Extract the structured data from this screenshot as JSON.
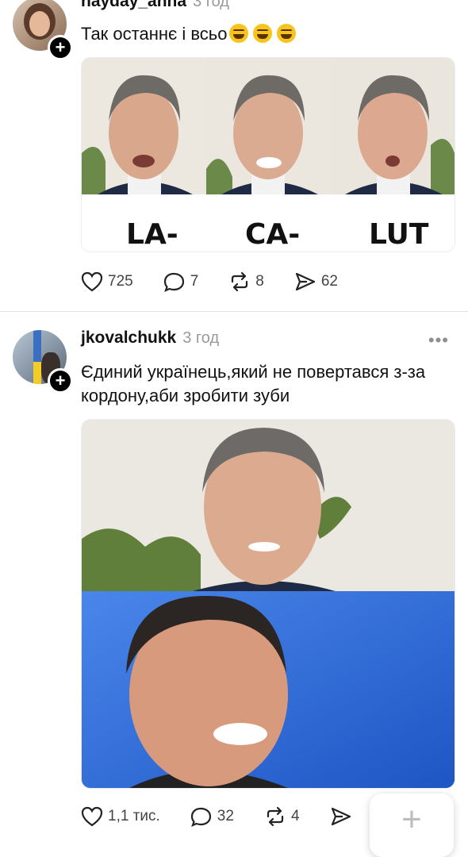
{
  "post1": {
    "username": "hayday_anna",
    "time": "3 год",
    "text": "Так останнє і всьо",
    "meme_labels": [
      "LA-",
      "CA-",
      "LUT"
    ],
    "likes": "725",
    "comments": "7",
    "reposts": "8",
    "shares": "62"
  },
  "post2": {
    "username": "jkovalchukk",
    "time": "3 год",
    "more": "•••",
    "text": "Єдиний українець,який не повертався з-за кордону,аби зробити зуби",
    "likes": "1,1 тис.",
    "comments": "32",
    "reposts": "4"
  },
  "fab": {
    "label": "+"
  },
  "colors": {
    "accent": "#000000",
    "muted": "#9a9a9a",
    "divider": "#e3e3e3"
  }
}
